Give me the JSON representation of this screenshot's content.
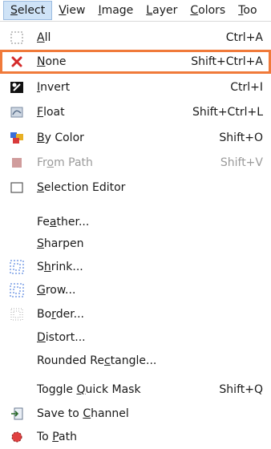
{
  "menubar": [
    {
      "pre": "",
      "u": "S",
      "post": "elect",
      "active": true
    },
    {
      "pre": "",
      "u": "V",
      "post": "iew"
    },
    {
      "pre": "",
      "u": "I",
      "post": "mage"
    },
    {
      "pre": "",
      "u": "L",
      "post": "ayer"
    },
    {
      "pre": "",
      "u": "C",
      "post": "olors"
    },
    {
      "pre": "",
      "u": "T",
      "post": "oo"
    }
  ],
  "menu": {
    "items": [
      {
        "name": "all",
        "icon": "select-all-icon",
        "pre": "",
        "u": "A",
        "post": "ll",
        "shortcut": "Ctrl+A"
      },
      {
        "name": "none",
        "icon": "select-none-icon",
        "pre": "",
        "u": "N",
        "post": "one",
        "shortcut": "Shift+Ctrl+A",
        "highlight": true
      },
      {
        "name": "invert",
        "icon": "invert-icon",
        "pre": "",
        "u": "I",
        "post": "nvert",
        "shortcut": "Ctrl+I"
      },
      {
        "name": "float",
        "icon": "float-icon",
        "pre": "",
        "u": "F",
        "post": "loat",
        "shortcut": "Shift+Ctrl+L"
      },
      {
        "name": "by-color",
        "icon": "by-color-icon",
        "pre": "",
        "u": "B",
        "post": "y Color",
        "shortcut": "Shift+O"
      },
      {
        "name": "from-path",
        "icon": "from-path-icon",
        "pre": "Fr",
        "u": "o",
        "post": "m Path",
        "shortcut": "Shift+V",
        "disabled": true
      },
      {
        "name": "selection-editor",
        "icon": "selection-editor-icon",
        "pre": "",
        "u": "S",
        "post": "election Editor",
        "shortcut": ""
      },
      {
        "name": "feather",
        "icon": "",
        "pre": "Fe",
        "u": "a",
        "post": "ther...",
        "shortcut": ""
      },
      {
        "name": "sharpen",
        "icon": "",
        "pre": "",
        "u": "S",
        "post": "harpen",
        "shortcut": ""
      },
      {
        "name": "shrink",
        "icon": "shrink-icon",
        "pre": "S",
        "u": "h",
        "post": "rink...",
        "shortcut": ""
      },
      {
        "name": "grow",
        "icon": "grow-icon",
        "pre": "",
        "u": "G",
        "post": "row...",
        "shortcut": ""
      },
      {
        "name": "border",
        "icon": "border-icon",
        "pre": "Bo",
        "u": "r",
        "post": "der...",
        "shortcut": ""
      },
      {
        "name": "distort",
        "icon": "",
        "pre": "",
        "u": "D",
        "post": "istort...",
        "shortcut": ""
      },
      {
        "name": "rounded-rectangle",
        "icon": "",
        "pre": "Rounded Re",
        "u": "c",
        "post": "tangle...",
        "shortcut": ""
      },
      {
        "name": "toggle-quick-mask",
        "icon": "",
        "pre": "Toggle ",
        "u": "Q",
        "post": "uick Mask",
        "shortcut": "Shift+Q"
      },
      {
        "name": "save-to-channel",
        "icon": "save-to-channel-icon",
        "pre": "Save to ",
        "u": "C",
        "post": "hannel",
        "shortcut": ""
      },
      {
        "name": "to-path",
        "icon": "to-path-icon",
        "pre": "To ",
        "u": "P",
        "post": "ath",
        "shortcut": ""
      }
    ]
  },
  "colors": {
    "highlight_border": "#f07a3a",
    "active_menu_bg": "#cfe3f7"
  }
}
